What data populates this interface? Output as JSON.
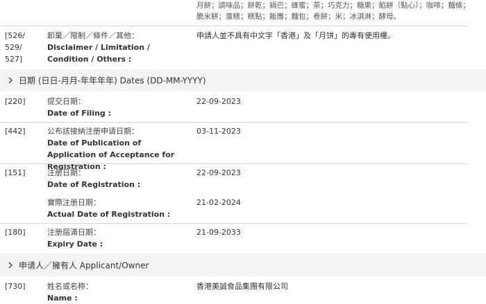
{
  "goods_text": "月餅；調味品；餅乾；鍋巴；蜂蜜；茶；巧克力；糖果；餡餅（點心）；咖啡；麵條；脆米餅；蛋糕；糕點；飯團；麵包；卷餅；米；冰淇淋；酵母。",
  "disclaimer": {
    "code": "[526/\n529/\n527]",
    "label_zh": "卸棄／限制／條件／其他：",
    "label_en": "Disclaimer / Limitation / Condition / Others :",
    "value": "申請人並不具有中文字「香港」及「月饼」的專有使用權。"
  },
  "dates_section": {
    "title": "日期 (日日-月月-年年年年) Dates (DD-MM-YYYY)"
  },
  "filing": {
    "code": "[220]",
    "label_zh": "提交日期：",
    "label_en": "Date of Filing :",
    "value": "22-09-2023"
  },
  "publication": {
    "code": "[442]",
    "label_zh": "公布該接納注册申请日期：",
    "label_en": "Date of Publication of Application of Acceptance for Registration :",
    "value": "03-11-2023"
  },
  "registration": {
    "code": "[151]",
    "label_zh": "注册日期：",
    "label_en": "Date of Registration :",
    "value": "22-09-2023"
  },
  "actual_registration": {
    "label_zh": "實際注册日期：",
    "label_en": "Actual Date of Registration :",
    "value": "21-02-2024"
  },
  "expiry": {
    "code": "[180]",
    "label_zh": "注册屆滿日期：",
    "label_en": "Expiry Date :",
    "value": "21-09-2033"
  },
  "applicant_section": {
    "title": "申请人／擁有人 Applicant/Owner"
  },
  "name": {
    "code": "[730]",
    "label_zh": "姓名或名称：",
    "label_en": "Name :",
    "value": "香港美誠食品集團有限公司"
  }
}
